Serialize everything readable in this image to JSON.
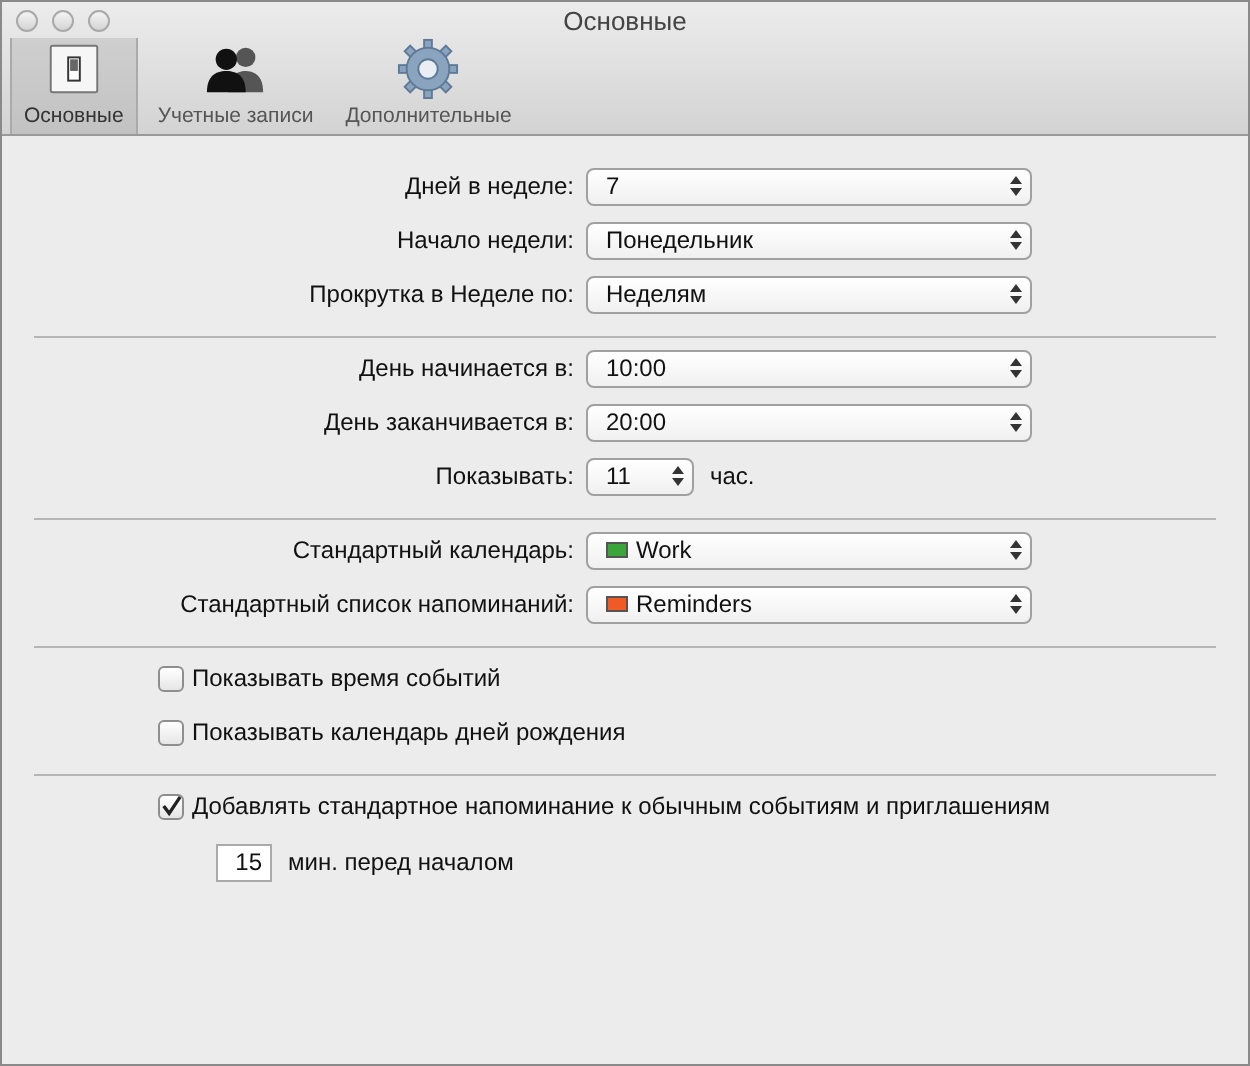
{
  "window": {
    "title": "Основные"
  },
  "toolbar": [
    {
      "label": "Основные",
      "kind": "switch",
      "selected": true
    },
    {
      "label": "Учетные записи",
      "kind": "people",
      "selected": false
    },
    {
      "label": "Дополнительные",
      "kind": "gear",
      "selected": false
    }
  ],
  "sections": [
    {
      "rows": [
        {
          "kind": "select",
          "label": "Дней в неделе:",
          "value": "7"
        },
        {
          "kind": "select",
          "label": "Начало недели:",
          "value": "Понедельник"
        },
        {
          "kind": "select",
          "label": "Прокрутка в Неделе по:",
          "value": "Неделям"
        }
      ]
    },
    {
      "rows": [
        {
          "kind": "select",
          "label": "День начинается в:",
          "value": "10:00"
        },
        {
          "kind": "select",
          "label": "День заканчивается в:",
          "value": "20:00"
        },
        {
          "kind": "stepper",
          "label": "Показывать:",
          "value": "11",
          "suffix": "час."
        }
      ]
    },
    {
      "rows": [
        {
          "kind": "select",
          "label": "Стандартный календарь:",
          "value": "Work",
          "color": "#3aa53a"
        },
        {
          "kind": "select",
          "label": "Стандартный список напоминаний:",
          "value": "Reminders",
          "color": "#f05a24"
        }
      ]
    },
    {
      "rows": [
        {
          "kind": "checkbox",
          "label": "Показывать время событий",
          "checked": false
        },
        {
          "kind": "checkbox",
          "label": "Показывать календарь дней рождения",
          "checked": false
        }
      ]
    },
    {
      "rows": [
        {
          "kind": "checkbox",
          "label": "Добавлять стандартное напоминание к обычным событиям и приглашениям",
          "checked": true
        },
        {
          "kind": "minutes",
          "value": "15",
          "suffix": "мин. перед началом"
        }
      ]
    }
  ]
}
